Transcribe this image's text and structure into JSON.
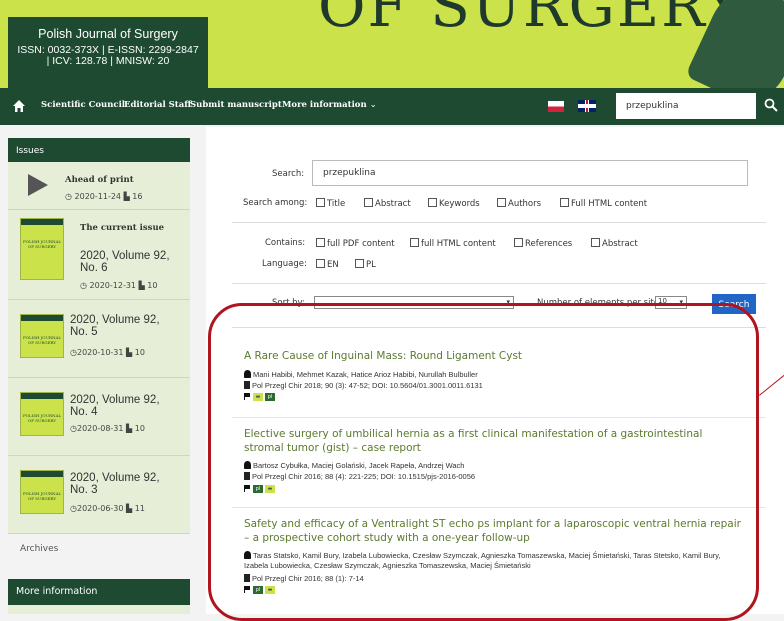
{
  "header": {
    "banner_title": "OF SURGERY",
    "journal_name": "Polish Journal of Surgery",
    "issn_line1": "ISSN: 0032-373X | E-ISSN: 2299-2847",
    "issn_line2": "| ICV: 128.78 | MNISW: 20"
  },
  "nav": {
    "items": [
      "Scientific Council",
      "Editorial Staff",
      "Submit manuscript",
      "More information"
    ],
    "search_value": "przepuklina",
    "colors": {
      "bar": "#1f4a32",
      "banner": "#cbe24a"
    }
  },
  "sidebar": {
    "issues_heading": "Issues",
    "ahead": {
      "label": "Ahead of print",
      "date": "2020-11-24",
      "count": "16"
    },
    "current": {
      "label": "The current issue",
      "volume": "2020, Volume 92, No. 6",
      "date": "2020-12-31",
      "count": "10"
    },
    "issues": [
      {
        "volume": "2020, Volume 92, No. 5",
        "date": "2020-10-31",
        "count": "10"
      },
      {
        "volume": "2020, Volume 92, No. 4",
        "date": "2020-08-31",
        "count": "10"
      },
      {
        "volume": "2020, Volume 92, No. 3",
        "date": "2020-06-30",
        "count": "11"
      }
    ],
    "archives": "Archives",
    "more_info": "More information",
    "cover_text": "POLISH JOURNAL OF SURGERY"
  },
  "search_form": {
    "search_label": "Search:",
    "search_value": "przepuklina",
    "among_label": "Search among:",
    "among_options": [
      "Title",
      "Abstract",
      "Keywords",
      "Authors",
      "Full HTML content"
    ],
    "contains_label": "Contains:",
    "contains_options": [
      "full PDF content",
      "full HTML content",
      "References",
      "Abstract"
    ],
    "language_label": "Language:",
    "language_options": [
      "EN",
      "PL"
    ],
    "sort_label": "Sort by:",
    "per_site_label": "Number of elements per site",
    "per_site_value": "10",
    "search_button": "Search"
  },
  "results": [
    {
      "title": "A Rare Cause of Inguinal Mass: Round Ligament Cyst",
      "authors": "Mani Habibi,  Mehmet Kazak,  Hatice Arioz Habibi,  Nurullah Bulbuller",
      "citation": "Pol Przegl Chir 2018; 90 (3): 47-52; DOI: 10.5604/01.3001.0011.6131"
    },
    {
      "title": "Elective surgery of umbilical hernia as a first clinical manifestation of a gastrointestinal stromal tumor (gist) – case report",
      "authors": "Bartosz Cybułka,  Maciej Golański,  Jacek Rapeła,  Andrzej Wach",
      "citation": "Pol Przegl Chir 2016; 88 (4): 221-225; DOI: 10.1515/pjs-2016-0056"
    },
    {
      "title": "Safety and efficacy of a Ventralight ST echo ps implant for a laparoscopic ventral hernia repair – a prospective cohort study with a one-year follow-up",
      "authors": "Taras Statsko,  Kamil Bury,  Izabela Lubowiecka,  Czesław Szymczak,  Agnieszka Tomaszewska,  Maciej Śmietański,  Taras Stetsko,  Kamil Bury,  Izabela Lubowiecka,  Czesław Szymczak,  Agnieszka Tomaszewska,  Maciej Śmietański",
      "citation": "Pol Przegl Chir 2016; 88 (1): 7-14"
    }
  ],
  "badges": {
    "pl": "pl",
    "en": "en"
  },
  "annotation_color": "#b0141c"
}
